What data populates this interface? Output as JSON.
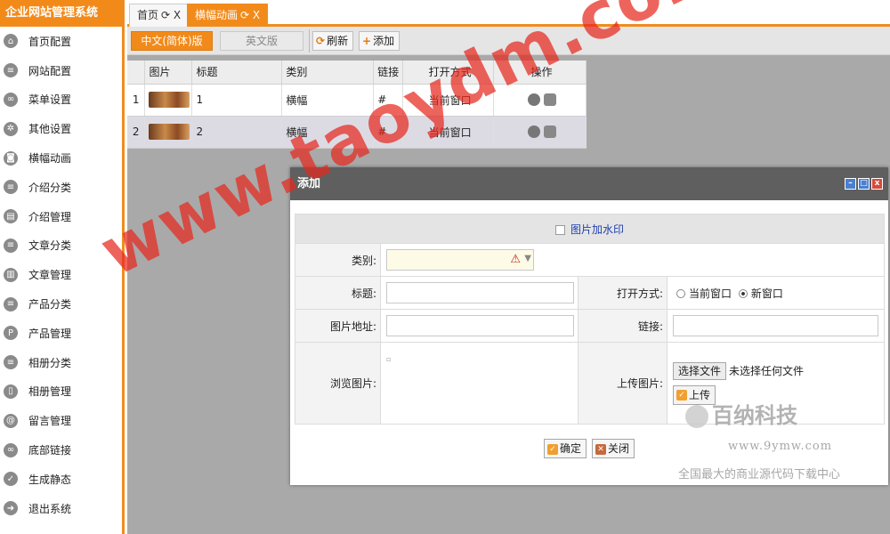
{
  "sidebar": {
    "title": "企业网站管理系统",
    "items": [
      {
        "label": "首页配置",
        "icon": "home-icon",
        "glyph": "⌂"
      },
      {
        "label": "网站配置",
        "icon": "list-icon",
        "glyph": "≡"
      },
      {
        "label": "菜单设置",
        "icon": "link-icon",
        "glyph": "∞"
      },
      {
        "label": "其他设置",
        "icon": "gear-icon",
        "glyph": "✲"
      },
      {
        "label": "横幅动画",
        "icon": "banner-icon",
        "glyph": "◙"
      },
      {
        "label": "介绍分类",
        "icon": "list-icon",
        "glyph": "≡"
      },
      {
        "label": "介绍管理",
        "icon": "document-icon",
        "glyph": "▤"
      },
      {
        "label": "文章分类",
        "icon": "list-icon",
        "glyph": "≡"
      },
      {
        "label": "文章管理",
        "icon": "article-icon",
        "glyph": "▥"
      },
      {
        "label": "产品分类",
        "icon": "list-icon",
        "glyph": "≡"
      },
      {
        "label": "产品管理",
        "icon": "product-icon",
        "glyph": "P"
      },
      {
        "label": "相册分类",
        "icon": "list-icon",
        "glyph": "≡"
      },
      {
        "label": "相册管理",
        "icon": "album-icon",
        "glyph": "▯"
      },
      {
        "label": "留言管理",
        "icon": "at-icon",
        "glyph": "@"
      },
      {
        "label": "底部链接",
        "icon": "link-icon",
        "glyph": "∞"
      },
      {
        "label": "生成静态",
        "icon": "check-icon",
        "glyph": "✓"
      },
      {
        "label": "退出系统",
        "icon": "exit-icon",
        "glyph": "➜"
      }
    ]
  },
  "tabs": [
    {
      "label": "首页",
      "close": "⟳ X"
    },
    {
      "label": "横幅动画",
      "close": "⟳ X"
    }
  ],
  "toolbar": {
    "lang_zh": "中文(简体)版",
    "lang_en": "英文版",
    "refresh_label": "刷新",
    "add_label": "添加"
  },
  "grid": {
    "headers": [
      "",
      "图片",
      "标题",
      "类别",
      "链接",
      "打开方式",
      "操作"
    ],
    "rows": [
      {
        "num": "1",
        "title": "1",
        "category": "横幅",
        "link": "#",
        "open": "当前窗口"
      },
      {
        "num": "2",
        "title": "2",
        "category": "横幅",
        "link": "#",
        "open": "当前窗口"
      }
    ]
  },
  "modal": {
    "title": "添加",
    "watermark_option": "图片加水印",
    "category_label": "类别:",
    "title_label": "标题:",
    "open_label": "打开方式:",
    "radio_current": "当前窗口",
    "radio_new": "新窗口",
    "url_label": "图片地址:",
    "link_label": "链接:",
    "preview_label": "浏览图片:",
    "upload_label": "上传图片:",
    "choose_file": "选择文件",
    "no_file": "未选择任何文件",
    "upload_button": "上传",
    "confirm": "确定",
    "close": "关闭"
  },
  "watermarks": {
    "main": "www.taoydm.com",
    "brand": "百纳科技",
    "url": "www.9ymw.com",
    "slogan": "全国最大的商业源代码下载中心"
  }
}
